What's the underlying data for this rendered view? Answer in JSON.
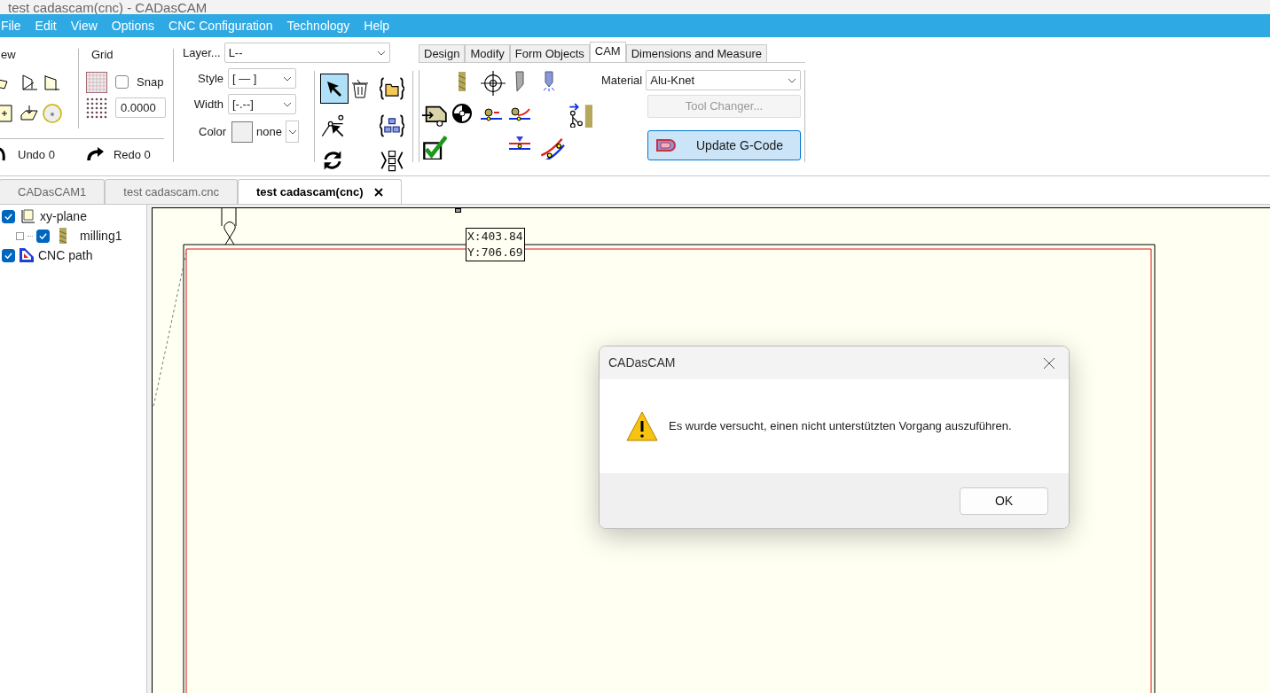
{
  "window": {
    "title": "test cadascam(cnc) - CADasCAM"
  },
  "menu": [
    {
      "label": "File"
    },
    {
      "label": "Edit"
    },
    {
      "label": "View"
    },
    {
      "label": "Options"
    },
    {
      "label": "CNC Configuration"
    },
    {
      "label": "Technology"
    },
    {
      "label": "Help"
    }
  ],
  "toolbar": {
    "view_label": "ew",
    "grid_label": "Grid",
    "snap": {
      "label": "Snap",
      "checked": false
    },
    "grid_value": "0.0000",
    "undo": "Undo 0",
    "redo": "Redo 0",
    "layer": {
      "label": "Layer...",
      "value": "L--"
    },
    "style": {
      "label": "Style",
      "value": "[ — ]"
    },
    "width": {
      "label": "Width",
      "value": "[-.--]"
    },
    "color": {
      "label": "Color",
      "value": "none"
    },
    "select_tool": {
      "selected": true
    }
  },
  "ribbon_tabs": [
    {
      "label": "Design",
      "selected": false
    },
    {
      "label": "Modify",
      "selected": false
    },
    {
      "label": "Form Objects",
      "selected": false
    },
    {
      "label": "CAM",
      "selected": true
    },
    {
      "label": "Dimensions and Measure",
      "selected": false
    }
  ],
  "cam": {
    "material_label": "Material",
    "material": "Alu-Knet",
    "tool_changer": {
      "label": "Tool Changer...",
      "disabled": true
    },
    "update": "Update G-Code"
  },
  "doc_tabs": [
    {
      "label": "CADasCAM1",
      "selected": false
    },
    {
      "label": "test cadascam.cnc",
      "selected": false
    },
    {
      "label": "test cadascam(cnc)",
      "selected": true
    }
  ],
  "tree": [
    {
      "label": "xy-plane",
      "checked": true,
      "children": [
        {
          "label": "milling1",
          "checked": true
        }
      ]
    },
    {
      "label": "CNC path",
      "checked": true
    }
  ],
  "canvas": {
    "x": "X:403.84",
    "y": "Y:706.69"
  },
  "dialog": {
    "title": "CADasCAM",
    "message": "Es wurde versucht, einen nicht unterstützten Vorgang auszuführen.",
    "ok": "OK"
  }
}
